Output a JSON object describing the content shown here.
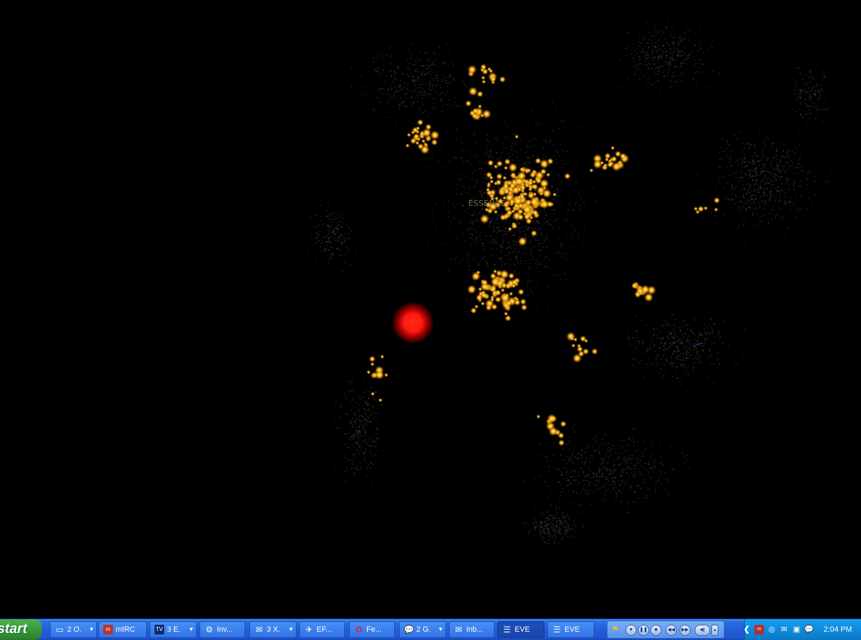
{
  "map": {
    "label": "ESSENCE",
    "beacon_color": "#ff1a10",
    "star_color": "#ffb020",
    "background": "#000000"
  },
  "taskbar": {
    "start_label": "start",
    "tasks": [
      {
        "label": "2 O.",
        "icon": "window-group-icon",
        "dropdown": true,
        "active": false
      },
      {
        "label": "mIRC",
        "icon": "mirc-icon",
        "dropdown": false,
        "active": false
      },
      {
        "label": "3 E.",
        "icon": "tv-icon",
        "dropdown": true,
        "active": false
      },
      {
        "label": "Inv...",
        "icon": "gear-icon",
        "dropdown": false,
        "active": false
      },
      {
        "label": "3 X.",
        "icon": "mail-icon",
        "dropdown": true,
        "active": false
      },
      {
        "label": "EF...",
        "icon": "satellite-icon",
        "dropdown": false,
        "active": false
      },
      {
        "label": "Fe...",
        "icon": "opera-icon",
        "dropdown": false,
        "active": false
      },
      {
        "label": "2 G.",
        "icon": "chat-bubble-icon",
        "dropdown": true,
        "active": false
      },
      {
        "label": "Inb...",
        "icon": "mailbox-icon",
        "dropdown": false,
        "active": false
      },
      {
        "label": "EVE",
        "icon": "eve-icon",
        "dropdown": false,
        "active": true
      },
      {
        "label": "EVE",
        "icon": "eve-icon",
        "dropdown": false,
        "active": false
      }
    ],
    "clock": "2:04 PM"
  }
}
